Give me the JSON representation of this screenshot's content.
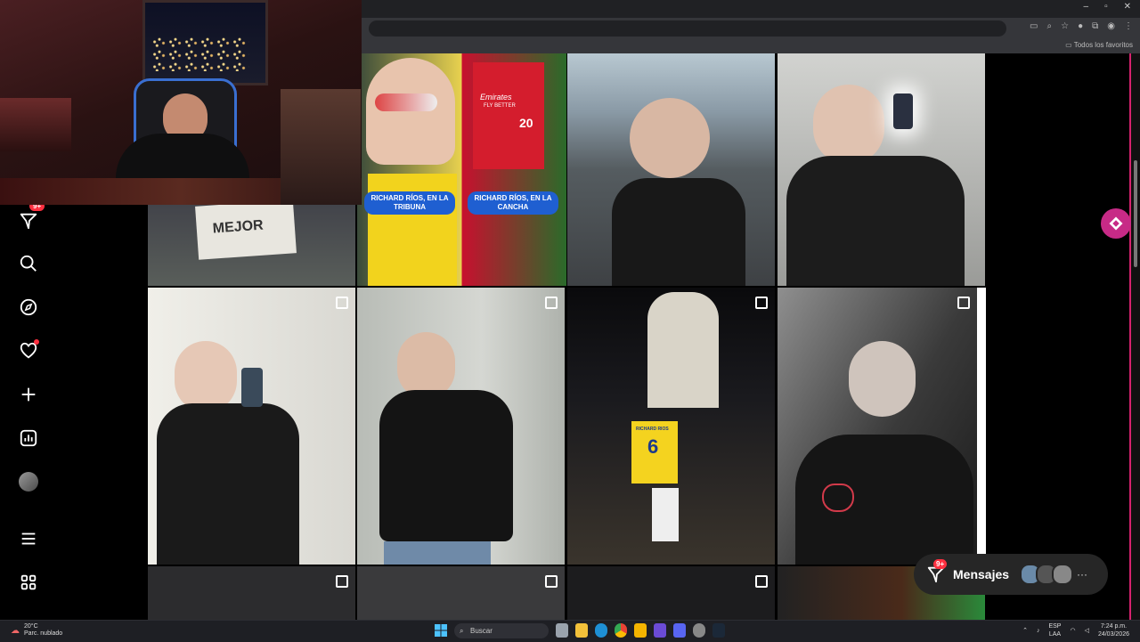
{
  "browser": {
    "bookmarks_label": "Todos los favoritos",
    "window_controls": [
      "–",
      "▫",
      "✕"
    ]
  },
  "sidebar": {
    "items": [
      {
        "name": "messages-icon",
        "badge": "9+"
      },
      {
        "name": "search-icon"
      },
      {
        "name": "explore-icon"
      },
      {
        "name": "notifications-icon",
        "has_dot": true
      },
      {
        "name": "create-icon"
      },
      {
        "name": "dashboard-icon"
      },
      {
        "name": "profile-avatar"
      },
      {
        "name": "menu-icon"
      },
      {
        "name": "apps-icon"
      }
    ]
  },
  "posts": [
    {
      "labels": [
        "RICHARD RÍOS, EN LA TRIBUNA",
        "RICHARD RÍOS, EN LA CANCHA"
      ],
      "multi": false
    },
    {
      "multi": false
    },
    {
      "multi": false
    },
    {
      "multi": true
    },
    {
      "multi": true
    },
    {
      "multi": true
    },
    {
      "multi": true
    }
  ],
  "post_texts": {
    "sign": "MEJOR",
    "jersey_number": "6",
    "jersey_name": "RICHARD RIOS",
    "benfica_sponsor": "Emirates",
    "benfica_sub": "FLY BETTER",
    "benfica_number": "20"
  },
  "messages_widget": {
    "label": "Mensajes",
    "badge": "9+",
    "more": "···"
  },
  "taskbar": {
    "weather_temp": "20°C",
    "weather_desc": "Parc. nublado",
    "search_placeholder": "Buscar",
    "lang_top": "ESP",
    "lang_bottom": "LAA",
    "time": "7:24 p.m.",
    "date": "24/03/2026"
  },
  "colors": {
    "accent_pink": "#d6226e",
    "badge_red": "#ff3040",
    "label_blue": "#1f5fd1"
  }
}
